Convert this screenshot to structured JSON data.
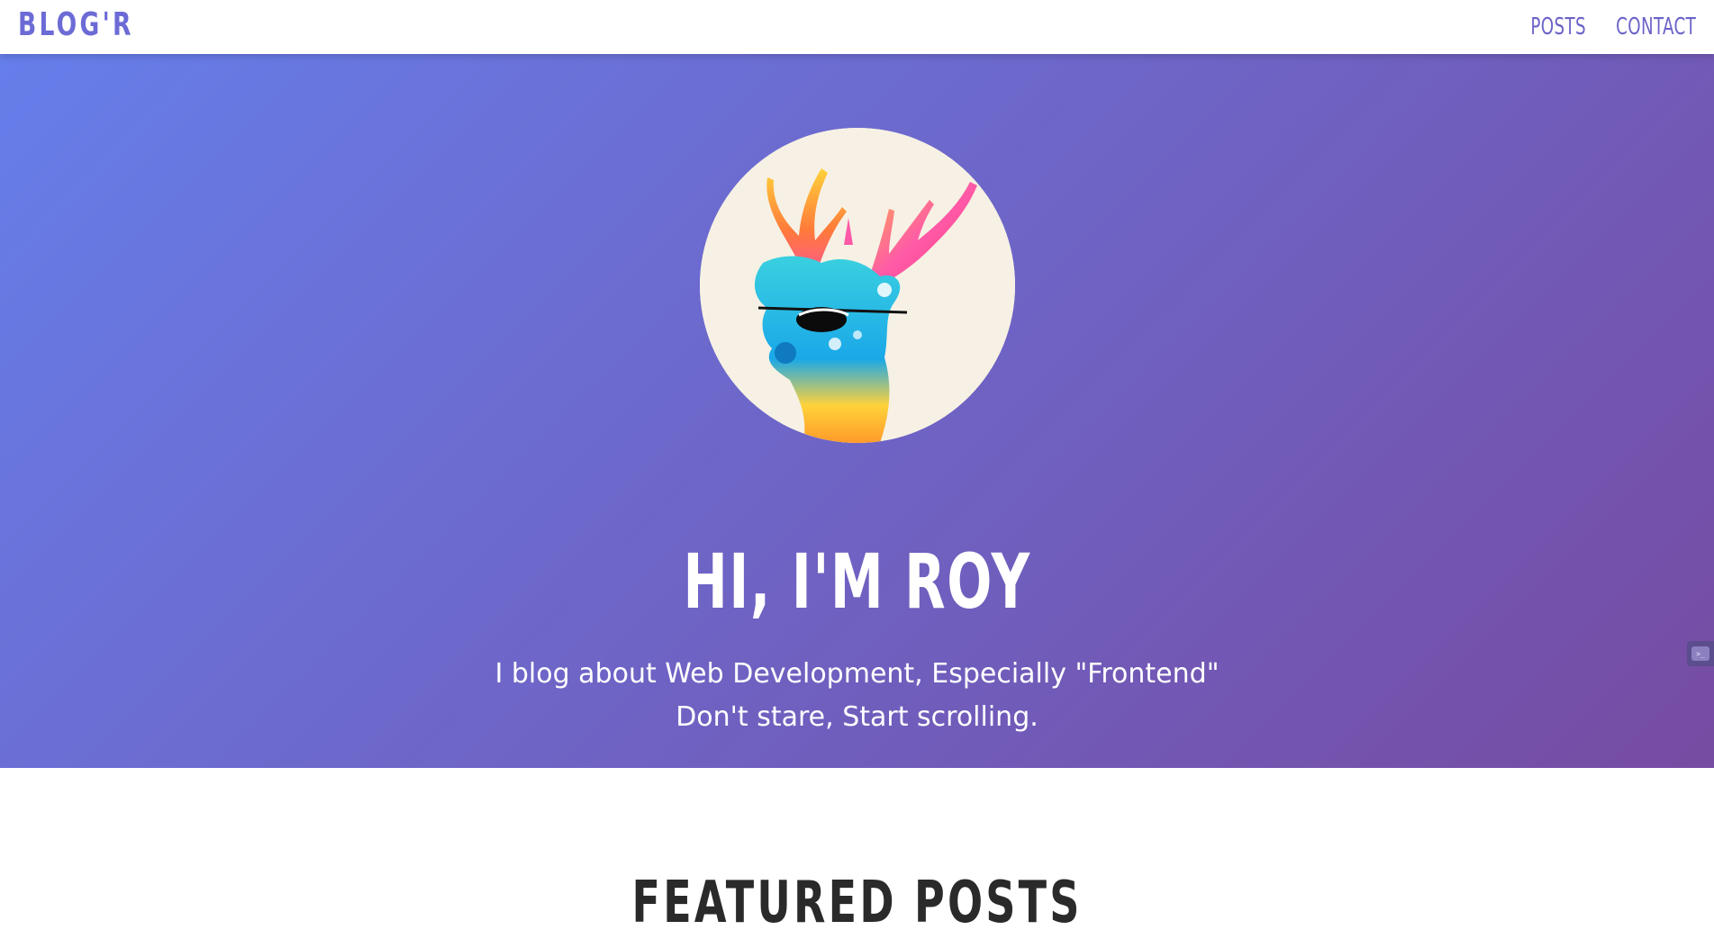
{
  "nav": {
    "logo": "BLOG'R",
    "links": [
      "POSTS",
      "CONTACT"
    ]
  },
  "hero": {
    "avatar_icon": "deer-avatar",
    "title": "HI, I'M ROY",
    "subtitle_line1": "I blog about Web Development, Especially \"Frontend\"",
    "subtitle_line2": "Don't stare, Start scrolling."
  },
  "featured": {
    "title": "FEATURED POSTS"
  },
  "colors": {
    "gradient_start": "#667eea",
    "gradient_end": "#764ba2",
    "nav_text": "#6a63c8",
    "logo_text": "#6c6bd6"
  }
}
